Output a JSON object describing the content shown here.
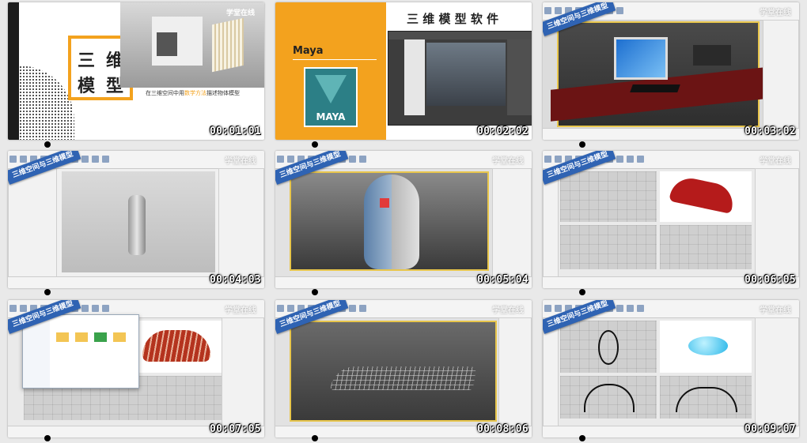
{
  "thumbnails": [
    {
      "timestamp": "00:01:01",
      "title_char1": "三",
      "title_char2": "维",
      "title_char3": "模",
      "title_char4": "型",
      "caption_prefix": "在三维空间中用",
      "caption_highlight": "数学方法",
      "caption_suffix": "描述物体模型",
      "watermark": "学堂在线"
    },
    {
      "timestamp": "00:02:02",
      "heading": "三 维 模 型 软 件",
      "software": "Maya",
      "logo_text": "MAYA"
    },
    {
      "timestamp": "00:03:02",
      "ribbon": "三维空间与三维模型",
      "watermark": "学堂在线"
    },
    {
      "timestamp": "00:04:03",
      "ribbon": "三维空间与三维模型",
      "watermark": "学堂在线"
    },
    {
      "timestamp": "00:05:04",
      "ribbon": "三维空间与三维模型",
      "watermark": "学堂在线"
    },
    {
      "timestamp": "00:06:05",
      "ribbon": "三维空间与三维模型",
      "watermark": "学堂在线"
    },
    {
      "timestamp": "00:07:05",
      "ribbon": "三维空间与三维模型",
      "watermark": "学堂在线"
    },
    {
      "timestamp": "00:08:06",
      "ribbon": "三维空间与三维模型",
      "watermark": "学堂在线"
    },
    {
      "timestamp": "00:09:07",
      "ribbon": "三维空间与三维模型",
      "watermark": "学堂在线"
    }
  ],
  "colors": {
    "accent_orange": "#f3a21e",
    "ribbon_blue": "#2f63b3",
    "maya_teal": "#2c7f86",
    "highlight_red": "#d9332b"
  }
}
